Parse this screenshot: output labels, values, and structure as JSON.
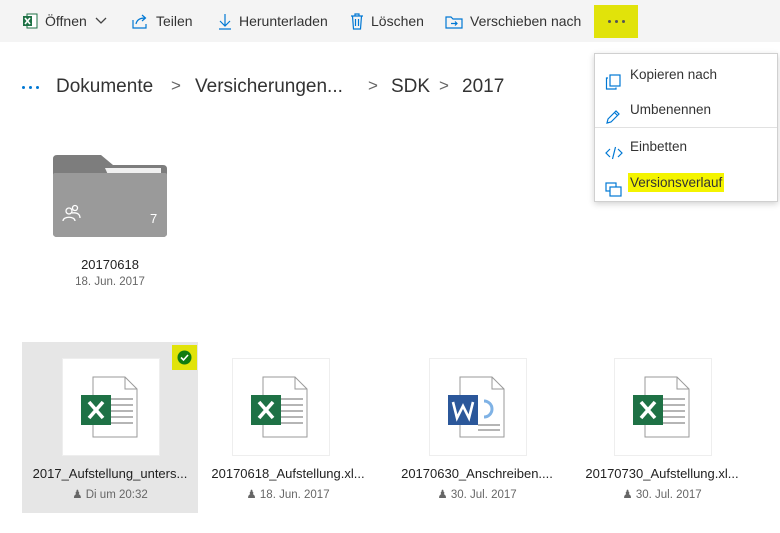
{
  "toolbar": {
    "open": "Öffnen",
    "share": "Teilen",
    "download": "Herunterladen",
    "delete": "Löschen",
    "move": "Verschieben nach"
  },
  "breadcrumb": [
    "Dokumente",
    "Versicherungen...",
    "SDK",
    "2017"
  ],
  "menu": {
    "copy": "Kopieren nach",
    "rename": "Umbenennen",
    "embed": "Einbetten",
    "history": "Versionsverlauf"
  },
  "folder": {
    "name": "20170618",
    "date": "18. Jun. 2017",
    "count": "7"
  },
  "files": [
    {
      "name": "2017_Aufstellung_unters...",
      "meta": "Di um 20:32",
      "type": "excel"
    },
    {
      "name": "20170618_Aufstellung.xl...",
      "meta": "18. Jun. 2017",
      "type": "excel"
    },
    {
      "name": "20170630_Anschreiben....",
      "meta": "30. Jul. 2017",
      "type": "word"
    },
    {
      "name": "20170730_Aufstellung.xl...",
      "meta": "30. Jul. 2017",
      "type": "excel"
    }
  ],
  "colors": {
    "highlight": "#e1e30a",
    "accent": "#0078d4",
    "excel": "#1e7145",
    "word": "#2b579a"
  },
  "icons": [
    "excel-icon",
    "share-icon",
    "download-icon",
    "trash-icon",
    "move-icon",
    "more-icon",
    "copy-icon",
    "pencil-icon",
    "embed-icon",
    "history-icon",
    "shared-people-icon",
    "checkmark-icon"
  ]
}
